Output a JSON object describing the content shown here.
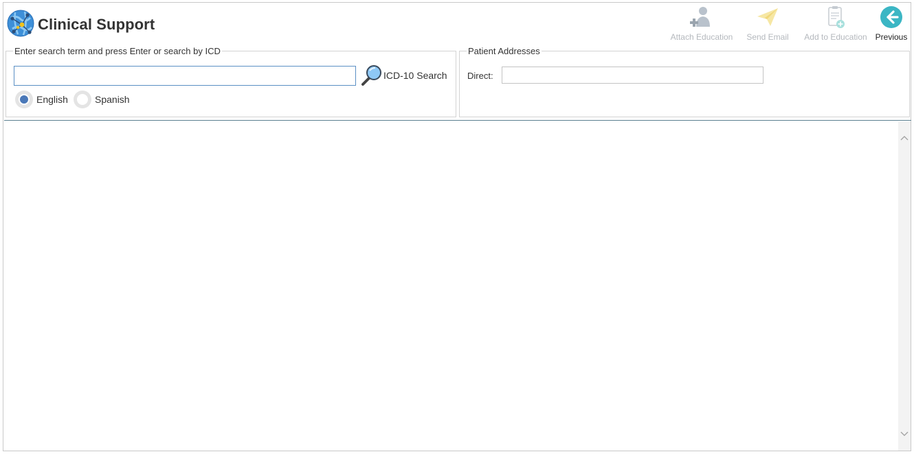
{
  "app": {
    "title": "Clinical Support",
    "logo_icon": "globe-network-icon"
  },
  "toolbar": {
    "attach_education": {
      "label": "Attach Education",
      "icon": "doctor-plus-icon",
      "enabled": false
    },
    "send_email": {
      "label": "Send Email",
      "icon": "paper-plane-icon",
      "enabled": false
    },
    "add_to_education": {
      "label": "Add to Education",
      "icon": "clipboard-add-icon",
      "enabled": false
    },
    "previous": {
      "label": "Previous",
      "icon": "arrow-left-circle-icon",
      "enabled": true
    }
  },
  "search": {
    "legend": "Enter search term and press Enter or search by ICD",
    "value": "",
    "placeholder": "",
    "icd_button_label": "ICD-10 Search",
    "icd_icon": "magnifier-icon",
    "languages": [
      {
        "label": "English",
        "selected": true
      },
      {
        "label": "Spanish",
        "selected": false
      }
    ]
  },
  "patient_addresses": {
    "legend": "Patient Addresses",
    "direct_label": "Direct:",
    "direct_value": ""
  },
  "colors": {
    "accent": "#4a78b8",
    "previous_button": "#3bb6c4",
    "disabled_text": "#b4b8bd",
    "input_focus_border": "#5a8fc4"
  }
}
